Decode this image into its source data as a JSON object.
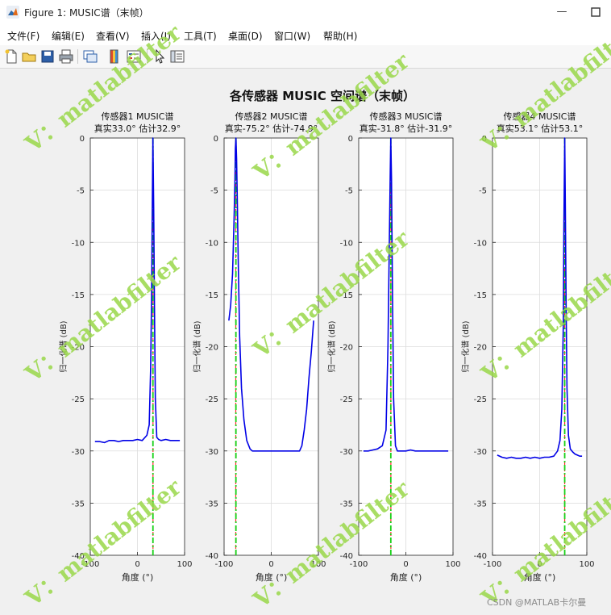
{
  "window": {
    "title": "Figure 1: MUSIC谱（末帧）",
    "minimize_icon": "minimize-icon",
    "maximize_icon": "maximize-icon"
  },
  "menu": [
    "文件(F)",
    "编辑(E)",
    "查看(V)",
    "插入(I)",
    "工具(T)",
    "桌面(D)",
    "窗口(W)",
    "帮助(H)"
  ],
  "toolbar_icons": [
    "new-file-icon",
    "open-folder-icon",
    "save-icon",
    "print-icon",
    "link-axes-icon",
    "colorbar-icon",
    "legend-icon",
    "pointer-icon",
    "property-editor-icon"
  ],
  "figure_title": "各传感器 MUSIC 空间谱（末帧）",
  "watermark_text": "V：matlabfilter",
  "footer": "CSDN @MATLAB卡尔曼",
  "colors": {
    "spectrum": "#0000e6",
    "true_line": "#ff2a2a",
    "est_line": "#19d119",
    "watermark": "#9ad84a"
  },
  "chart_data": [
    {
      "type": "line",
      "title": "传感器1  MUSIC谱",
      "subtitle": "真实33.0°  估计32.9°",
      "xlabel": "角度 (°)",
      "ylabel": "归一化谱 (dB)",
      "xlim": [
        -100,
        100
      ],
      "ylim": [
        -40,
        0
      ],
      "xticks": [
        -100,
        0,
        100
      ],
      "yticks": [
        0,
        -5,
        -10,
        -15,
        -20,
        -25,
        -30,
        -35,
        -40
      ],
      "grid": true,
      "true_angle": 33.0,
      "est_angle": 32.9,
      "series": [
        {
          "x": [
            -90,
            -80,
            -70,
            -60,
            -50,
            -40,
            -30,
            -20,
            -10,
            0,
            10,
            20,
            25,
            28,
            30,
            31.5,
            32.9,
            34.5,
            36,
            38,
            41,
            45,
            50,
            60,
            70,
            80,
            90
          ],
          "values": [
            -29.1,
            -29.1,
            -29.2,
            -29.0,
            -29.0,
            -29.1,
            -29.0,
            -29.0,
            -29.0,
            -28.9,
            -29.0,
            -28.5,
            -27.5,
            -22.0,
            -15.0,
            -7.0,
            0.0,
            -7.0,
            -16.0,
            -25.0,
            -28.7,
            -28.9,
            -29.0,
            -28.9,
            -29.0,
            -29.0,
            -29.0
          ]
        }
      ]
    },
    {
      "type": "line",
      "title": "传感器2  MUSIC谱",
      "subtitle": "真实-75.2°  估计-74.9°",
      "xlabel": "角度 (°)",
      "ylabel": "归一化谱 (dB)",
      "xlim": [
        -100,
        100
      ],
      "ylim": [
        -40,
        0
      ],
      "xticks": [
        -100,
        0,
        100
      ],
      "yticks": [
        0,
        -5,
        -10,
        -15,
        -20,
        -25,
        -30,
        -35,
        -40
      ],
      "grid": true,
      "true_angle": -75.2,
      "est_angle": -74.9,
      "series": [
        {
          "x": [
            -90,
            -86,
            -82,
            -79,
            -77,
            -76,
            -74.9,
            -73.5,
            -72,
            -70,
            -67,
            -63,
            -58,
            -52,
            -45,
            -40,
            -30,
            -20,
            -10,
            0,
            10,
            20,
            30,
            40,
            50,
            60,
            65,
            70,
            75,
            80,
            85,
            90
          ],
          "values": [
            -17.5,
            -16.0,
            -13.0,
            -8.0,
            -4.0,
            -1.0,
            0.0,
            -2.0,
            -6.0,
            -12.0,
            -19.0,
            -24.0,
            -27.0,
            -29.0,
            -29.8,
            -30.0,
            -30.0,
            -30.0,
            -30.0,
            -30.0,
            -30.0,
            -30.0,
            -30.0,
            -30.0,
            -30.0,
            -30.0,
            -29.5,
            -28.0,
            -26.0,
            -23.0,
            -20.5,
            -17.5
          ]
        }
      ]
    },
    {
      "type": "line",
      "title": "传感器3  MUSIC谱",
      "subtitle": "真实-31.8°  估计-31.9°",
      "xlabel": "角度 (°)",
      "ylabel": "归一化谱 (dB)",
      "xlim": [
        -100,
        100
      ],
      "ylim": [
        -40,
        0
      ],
      "xticks": [
        -100,
        0,
        100
      ],
      "yticks": [
        0,
        -5,
        -10,
        -15,
        -20,
        -25,
        -30,
        -35,
        -40
      ],
      "grid": true,
      "true_angle": -31.8,
      "est_angle": -31.9,
      "series": [
        {
          "x": [
            -90,
            -80,
            -70,
            -60,
            -50,
            -42,
            -38,
            -35,
            -33,
            -31.9,
            -30.5,
            -28.5,
            -26,
            -22,
            -18,
            -10,
            0,
            10,
            20,
            30,
            40,
            50,
            60,
            70,
            80,
            90
          ],
          "values": [
            -30.0,
            -30.0,
            -29.9,
            -29.8,
            -29.5,
            -28.0,
            -20.0,
            -10.0,
            -3.0,
            0.0,
            -4.0,
            -14.0,
            -25.0,
            -29.5,
            -30.0,
            -30.0,
            -30.0,
            -29.9,
            -30.0,
            -30.0,
            -30.0,
            -30.0,
            -30.0,
            -30.0,
            -30.0,
            -30.0
          ]
        }
      ]
    },
    {
      "type": "line",
      "title": "传感器4  MUSIC谱",
      "subtitle": "真实53.1°  估计53.1°",
      "xlabel": "角度 (°)",
      "ylabel": "归一化谱 (dB)",
      "xlim": [
        -100,
        100
      ],
      "ylim": [
        -40,
        0
      ],
      "xticks": [
        -100,
        0,
        100
      ],
      "yticks": [
        0,
        -5,
        -10,
        -15,
        -20,
        -25,
        -30,
        -35,
        -40
      ],
      "grid": true,
      "true_angle": 53.1,
      "est_angle": 53.1,
      "series": [
        {
          "x": [
            -90,
            -80,
            -70,
            -60,
            -50,
            -40,
            -30,
            -20,
            -10,
            0,
            10,
            20,
            30,
            38,
            43,
            47,
            50,
            51.5,
            53.1,
            54.5,
            56,
            58,
            61,
            65,
            70,
            75,
            80,
            85,
            90
          ],
          "values": [
            -30.4,
            -30.6,
            -30.7,
            -30.6,
            -30.7,
            -30.7,
            -30.6,
            -30.7,
            -30.6,
            -30.7,
            -30.6,
            -30.6,
            -30.5,
            -30.0,
            -29.0,
            -26.0,
            -18.0,
            -8.0,
            0.0,
            -7.0,
            -16.0,
            -24.0,
            -28.5,
            -29.8,
            -30.1,
            -30.3,
            -30.4,
            -30.5,
            -30.5
          ]
        }
      ]
    }
  ]
}
